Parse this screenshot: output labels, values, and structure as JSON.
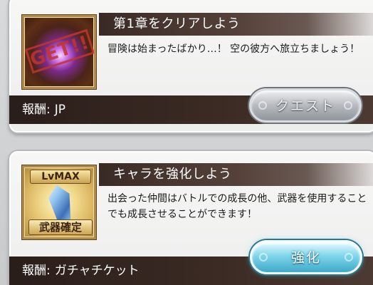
{
  "missions": [
    {
      "title": "第1章をクリアしよう",
      "description": "冒険は始まったばかり…！ 空の彼方へ旅立ちましょう！",
      "thumbnail_stamp": "GET!!",
      "reward_label": "報酬:",
      "reward_value": "JP",
      "button_label": "クエスト",
      "button_style": "gray"
    },
    {
      "title": "キャラを強化しよう",
      "description": "出会った仲間はバトルでの成長の他、武器を使用することでも成長させることができます！",
      "thumbnail_top_label": "LvMAX",
      "thumbnail_bottom_label": "武器確定",
      "reward_label": "報酬:",
      "reward_value": "ガチャチケット",
      "button_label": "強化",
      "button_style": "blue"
    }
  ],
  "colors": {
    "title_bar": "#3a2a25",
    "reward_bar": "#2a1e1a",
    "button_gray": "#b7bbbf",
    "button_blue": "#7fd6ea"
  }
}
